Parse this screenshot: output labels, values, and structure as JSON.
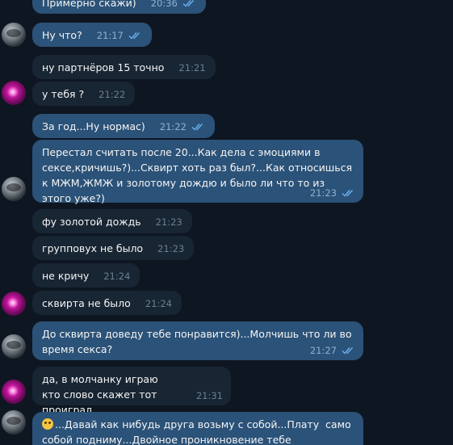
{
  "messages": [
    {
      "dir": "out",
      "text": "Примерно скажи)",
      "time": "20:36",
      "read": true
    },
    {
      "dir": "out",
      "text": "Ну что?",
      "time": "21:17",
      "read": true
    },
    {
      "dir": "in",
      "text": "ну партнёров 15 точно",
      "time": "21:21"
    },
    {
      "dir": "in",
      "text": "у тебя ?",
      "time": "21:22"
    },
    {
      "dir": "out",
      "text": "За год...Ну нормас)",
      "time": "21:22",
      "read": true
    },
    {
      "dir": "out",
      "text": "Перестал считать после 20...Как дела с эмоциями в сексе,кричишь?)...Сквирт хоть раз был?...Как относишься к МЖМ,ЖМЖ и золотому дождю и было ли что то из этого уже?)",
      "time": "21:23",
      "read": true
    },
    {
      "dir": "in",
      "text": "фу золотой дождь",
      "time": "21:23"
    },
    {
      "dir": "in",
      "text": "групповух не было",
      "time": "21:23"
    },
    {
      "dir": "in",
      "text": "не кричу",
      "time": "21:24"
    },
    {
      "dir": "in",
      "text": "сквирта не было",
      "time": "21:24"
    },
    {
      "dir": "out",
      "text": "До сквирта доведу тебе понравится)...Молчишь что ли во время секса?",
      "time": "21:27",
      "read": true
    },
    {
      "dir": "in",
      "text": "да, в молчанку играю\nкто слово скажет тот проиграл",
      "time": "21:31"
    },
    {
      "dir": "out",
      "emoji": "grinning-sweat-emoji",
      "text": "...Давай как нибудь друга возьму с собой...Плату  само собой подниму...Двойное проникновение тебе понравится...Кончишь",
      "time": "",
      "read": false
    }
  ],
  "colors": {
    "background": "#0e1621",
    "outgoing_bubble": "#2b5278",
    "incoming_bubble": "#182533",
    "read_ticks": "#6ab2f2"
  }
}
